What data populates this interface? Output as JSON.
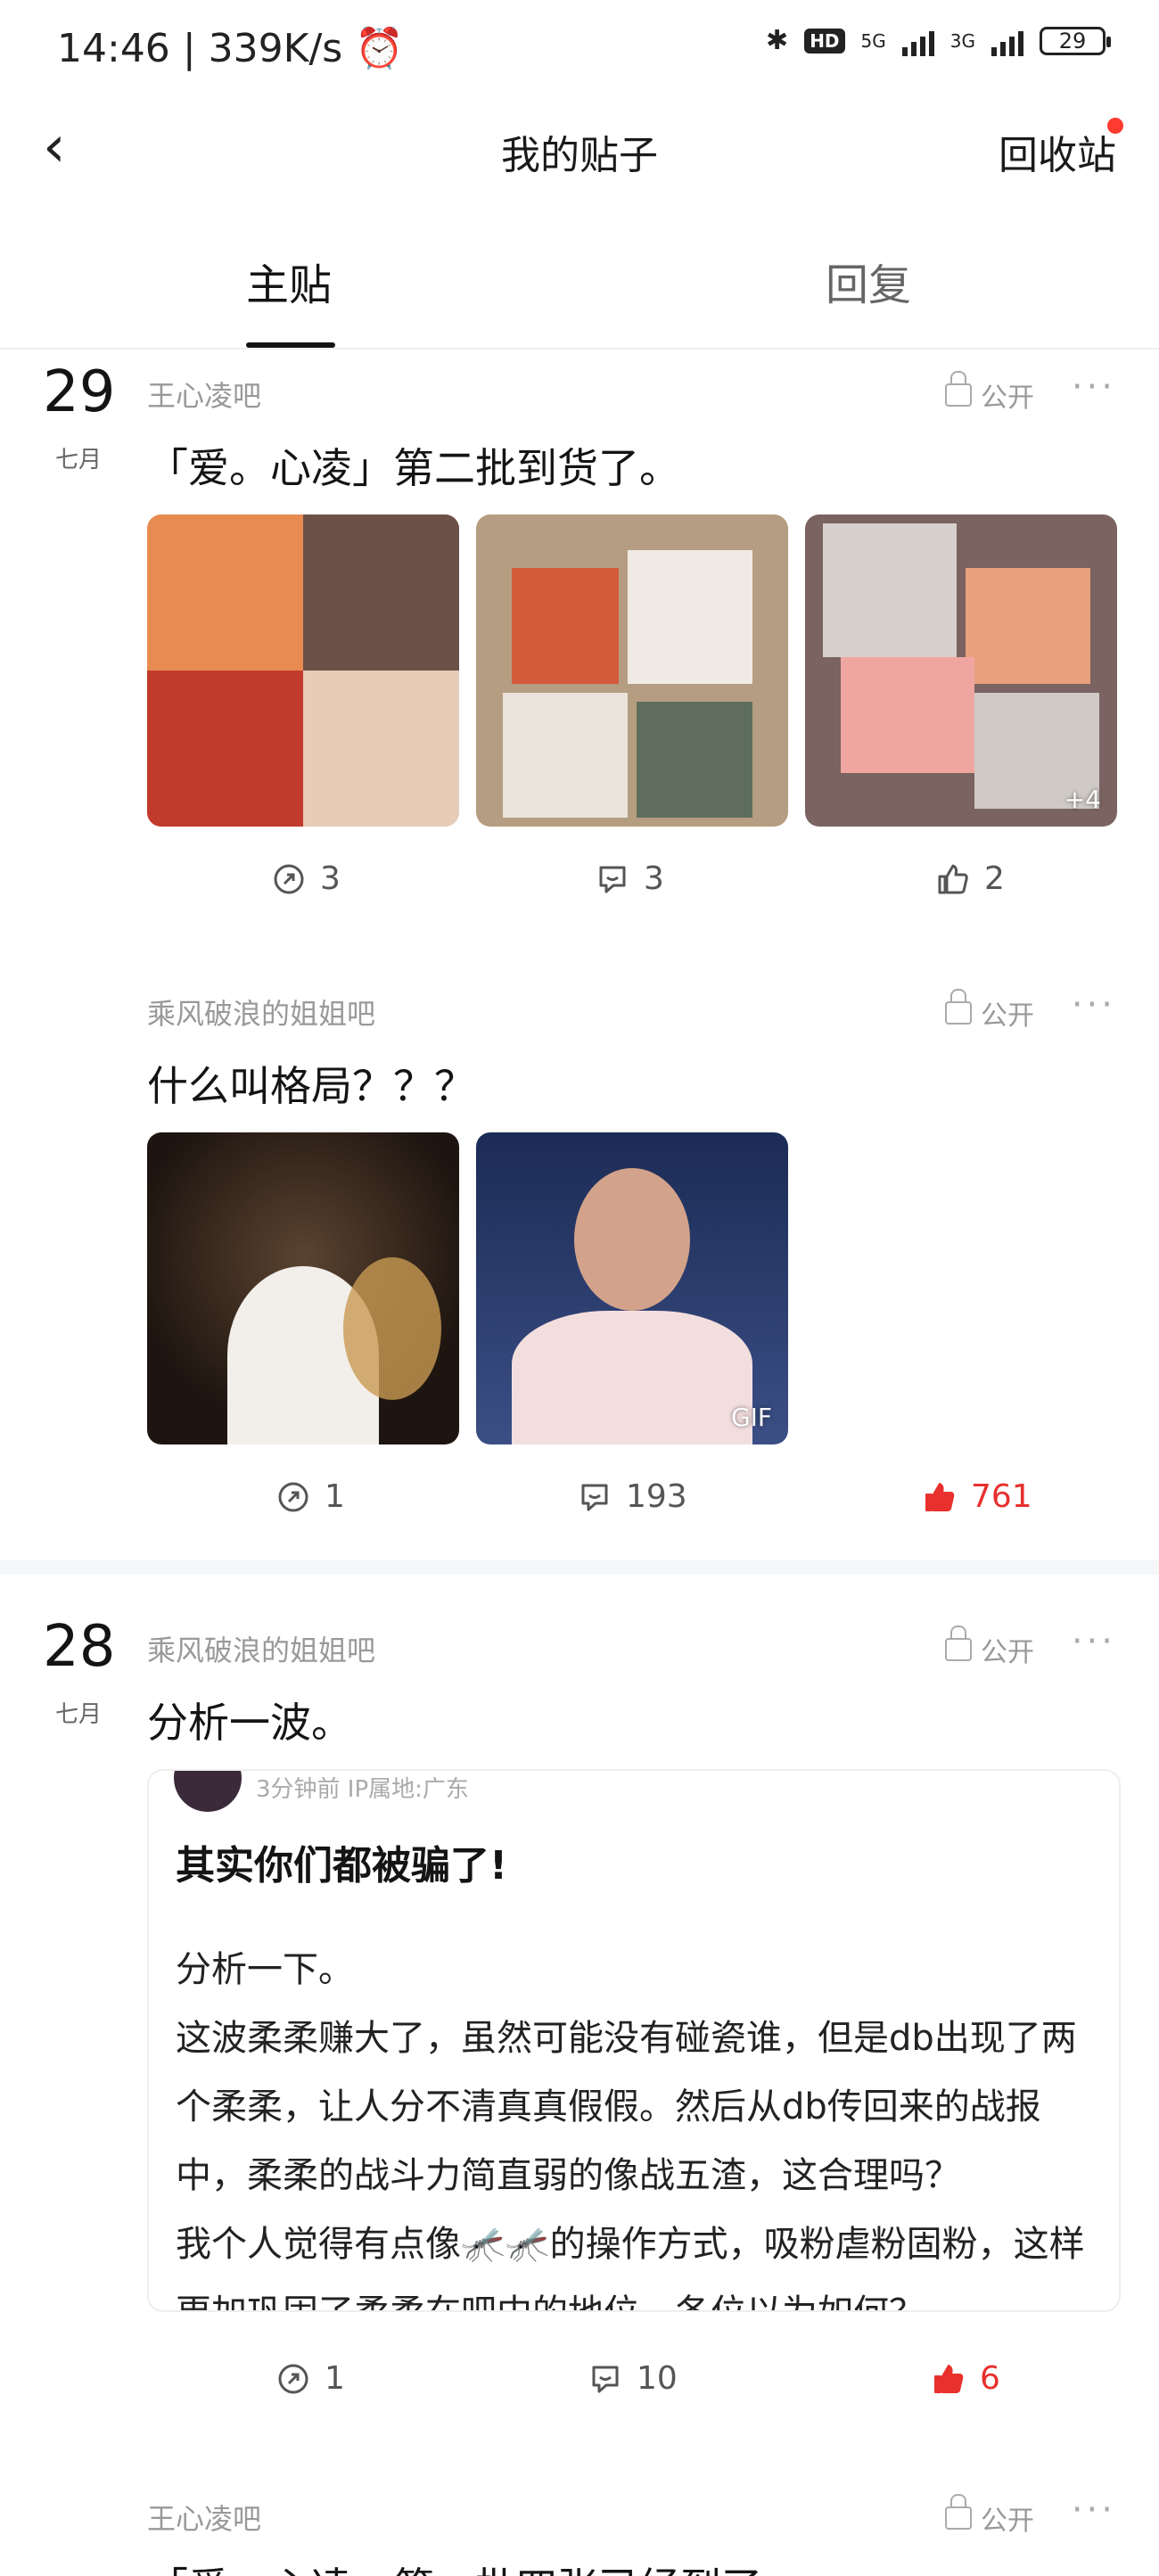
{
  "status_bar": {
    "time": "14:46",
    "speed": "339K/s",
    "net1": "5G",
    "net2": "3G",
    "hd": "HD",
    "battery": "29"
  },
  "nav": {
    "back": "‹",
    "title": "我的贴子",
    "recycle": "回收站"
  },
  "tabs": {
    "main": "主贴",
    "reply": "回复"
  },
  "posts": [
    {
      "day": "29",
      "month": "七月",
      "forum": "王心凌吧",
      "visibility": "公开",
      "title": "「爱。心凌」第二批到货了。",
      "images": [
        {
          "bg": "#c76a3a",
          "tag": ""
        },
        {
          "bg": "#b7a58c",
          "tag": ""
        },
        {
          "bg": "#8b6f6a",
          "tag": "+4"
        }
      ],
      "shares": "3",
      "comments": "3",
      "likes": "2",
      "liked": false
    },
    {
      "forum": "乘风破浪的姐姐吧",
      "visibility": "公开",
      "title": "什么叫格局？？？",
      "images": [
        {
          "bg": "#3b2a20",
          "tag": ""
        },
        {
          "bg": "#2a3c6a",
          "tag": "GIF"
        }
      ],
      "shares": "1",
      "comments": "193",
      "likes": "761",
      "liked": true
    },
    {
      "day": "28",
      "month": "七月",
      "forum": "乘风破浪的姐姐吧",
      "visibility": "公开",
      "title": "分析一波。",
      "quote": {
        "meta": "3分钟前   IP属地:广东",
        "title": "其实你们都被骗了!",
        "body1": "分析一下。",
        "body2": "这波柔柔赚大了，虽然可能没有碰瓷谁，但是db出现了两个柔柔，让人分不清真真假假。然后从db传回来的战报中，柔柔的战斗力简直弱的像战五渣，这合理吗？",
        "body3": "我个人觉得有点像🦟🦟的操作方式，吸粉虐粉固粉，这样更加巩固了柔柔在吧中的地位。各位以为如何？"
      },
      "shares": "1",
      "comments": "10",
      "likes": "6",
      "liked": true
    },
    {
      "forum": "王心凌吧",
      "visibility": "公开",
      "title": "「爱。心凌」第一批四张已经到了。"
    }
  ],
  "colors": {
    "liked": "#e8302d",
    "muted": "#999999"
  }
}
